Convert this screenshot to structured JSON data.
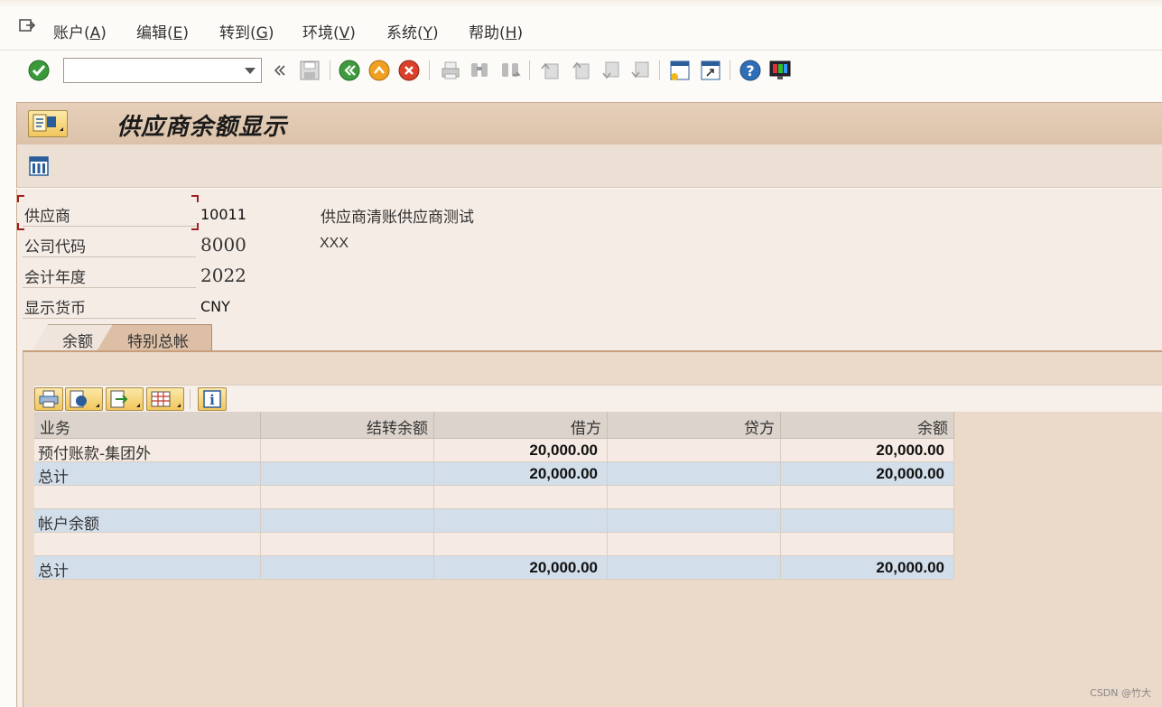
{
  "menu": {
    "items": [
      {
        "text": "账户(",
        "acc": "A",
        "end": ")"
      },
      {
        "text": "编辑(",
        "acc": "E",
        "end": ")"
      },
      {
        "text": "转到(",
        "acc": "G",
        "end": ")"
      },
      {
        "text": "环境(",
        "acc": "V",
        "end": ")"
      },
      {
        "text": "系统(",
        "acc": "Y",
        "end": ")"
      },
      {
        "text": "帮助(",
        "acc": "H",
        "end": ")"
      }
    ]
  },
  "toolbar": {
    "command_field_value": "",
    "icons": [
      "enter-icon",
      "back-double-arrow-icon",
      "save-icon",
      "back-icon",
      "exit-icon",
      "cancel-icon",
      "print-icon",
      "find-icon",
      "find-next-icon",
      "first-page-icon",
      "previous-page-icon",
      "next-page-icon",
      "last-page-icon",
      "create-session-icon",
      "shortcut-icon",
      "help-icon",
      "customize-layout-icon"
    ]
  },
  "title": {
    "text": "供应商余额显示"
  },
  "header_fields": {
    "vendor": {
      "label": "供应商",
      "value": "10011",
      "desc": "供应商清账供应商测试"
    },
    "company_code": {
      "label": "公司代码",
      "value": "8000",
      "desc": "XXX"
    },
    "fiscal_year": {
      "label": "会计年度",
      "value": "2022"
    },
    "display_currency": {
      "label": "显示货币",
      "value": "CNY"
    }
  },
  "tabs": [
    {
      "label": "余额",
      "active": false
    },
    {
      "label": "特别总帐",
      "active": true
    }
  ],
  "grid": {
    "columns": [
      "业务",
      "结转余额",
      "借方",
      "贷方",
      "余额"
    ],
    "rows": [
      {
        "cells": [
          "预付账款-集团外",
          "",
          "20,000.00",
          "",
          "20,000.00"
        ],
        "style": "light"
      },
      {
        "cells": [
          "总计",
          "",
          "20,000.00",
          "",
          "20,000.00"
        ],
        "style": "blue"
      },
      {
        "cells": [
          "",
          "",
          "",
          "",
          ""
        ],
        "style": "light"
      },
      {
        "cells": [
          "帐户余额",
          "",
          "",
          "",
          ""
        ],
        "style": "blue"
      },
      {
        "cells": [
          "",
          "",
          "",
          "",
          ""
        ],
        "style": "light"
      },
      {
        "cells": [
          "总计",
          "",
          "20,000.00",
          "",
          "20,000.00"
        ],
        "style": "blue"
      }
    ]
  },
  "watermark": "CSDN @竹大",
  "colors": {
    "title_bar": "#dcc2a9",
    "content_bg": "#f5ece6",
    "total_row": "#d3deeb",
    "focus_corner": "#a02020"
  }
}
